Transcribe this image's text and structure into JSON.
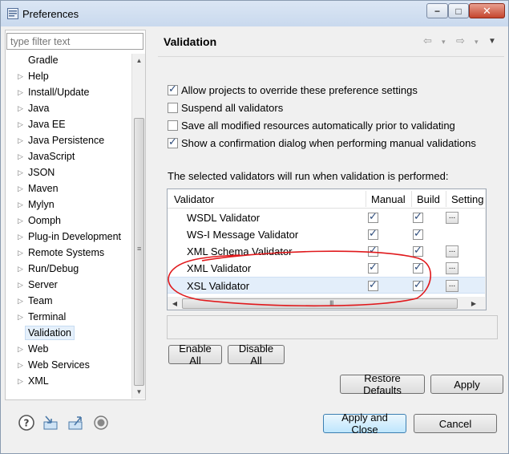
{
  "window": {
    "title": "Preferences",
    "controls": {
      "minimize": "−",
      "maximize": "□",
      "close": "✕"
    }
  },
  "filter": {
    "placeholder": "type filter text",
    "value": ""
  },
  "tree": {
    "items": [
      {
        "label": "Gradle",
        "expandable": false,
        "selected": false
      },
      {
        "label": "Help",
        "expandable": true,
        "selected": false
      },
      {
        "label": "Install/Update",
        "expandable": true,
        "selected": false
      },
      {
        "label": "Java",
        "expandable": true,
        "selected": false
      },
      {
        "label": "Java EE",
        "expandable": true,
        "selected": false
      },
      {
        "label": "Java Persistence",
        "expandable": true,
        "selected": false
      },
      {
        "label": "JavaScript",
        "expandable": true,
        "selected": false
      },
      {
        "label": "JSON",
        "expandable": true,
        "selected": false
      },
      {
        "label": "Maven",
        "expandable": true,
        "selected": false
      },
      {
        "label": "Mylyn",
        "expandable": true,
        "selected": false
      },
      {
        "label": "Oomph",
        "expandable": true,
        "selected": false
      },
      {
        "label": "Plug-in Development",
        "expandable": true,
        "selected": false
      },
      {
        "label": "Remote Systems",
        "expandable": true,
        "selected": false
      },
      {
        "label": "Run/Debug",
        "expandable": true,
        "selected": false
      },
      {
        "label": "Server",
        "expandable": true,
        "selected": false
      },
      {
        "label": "Team",
        "expandable": true,
        "selected": false
      },
      {
        "label": "Terminal",
        "expandable": true,
        "selected": false
      },
      {
        "label": "Validation",
        "expandable": false,
        "selected": true
      },
      {
        "label": "Web",
        "expandable": true,
        "selected": false
      },
      {
        "label": "Web Services",
        "expandable": true,
        "selected": false
      },
      {
        "label": "XML",
        "expandable": true,
        "selected": false
      }
    ],
    "scroll_grip": "≡"
  },
  "page": {
    "title": "Validation",
    "nav": {
      "back": "⇦",
      "forward": "⇨",
      "dropdown": "▾",
      "menu": "▼"
    }
  },
  "options": [
    {
      "label": "Allow projects to override these preference settings",
      "checked": true
    },
    {
      "label": "Suspend all validators",
      "checked": false
    },
    {
      "label": "Save all modified resources automatically prior to validating",
      "checked": false
    },
    {
      "label": "Show a confirmation dialog when performing manual validations",
      "checked": true
    }
  ],
  "info_text": "The selected validators will run when validation is performed:",
  "validators": {
    "columns": {
      "validator": "Validator",
      "manual": "Manual",
      "build": "Build",
      "settings": "Setting"
    },
    "rows": [
      {
        "name": "WSDL Validator",
        "manual": true,
        "build": true,
        "has_settings": true,
        "selected": false
      },
      {
        "name": "WS-I Message Validator",
        "manual": true,
        "build": true,
        "has_settings": false,
        "selected": false
      },
      {
        "name": "XML Schema Validator",
        "manual": true,
        "build": true,
        "has_settings": true,
        "selected": false
      },
      {
        "name": "XML Validator",
        "manual": true,
        "build": true,
        "has_settings": true,
        "selected": false
      },
      {
        "name": "XSL Validator",
        "manual": true,
        "build": true,
        "has_settings": true,
        "selected": true
      }
    ],
    "ellipsis": "...",
    "h_grip": "III"
  },
  "buttons": {
    "enable_all": "Enable All",
    "disable_all": "Disable All",
    "restore_defaults": "Restore Defaults",
    "apply": "Apply",
    "apply_and_close": "Apply and Close",
    "cancel": "Cancel"
  },
  "colors": {
    "annotation": "#e0191c",
    "selection": "#e3eefa",
    "primary_button_border": "#3c7fb1"
  }
}
